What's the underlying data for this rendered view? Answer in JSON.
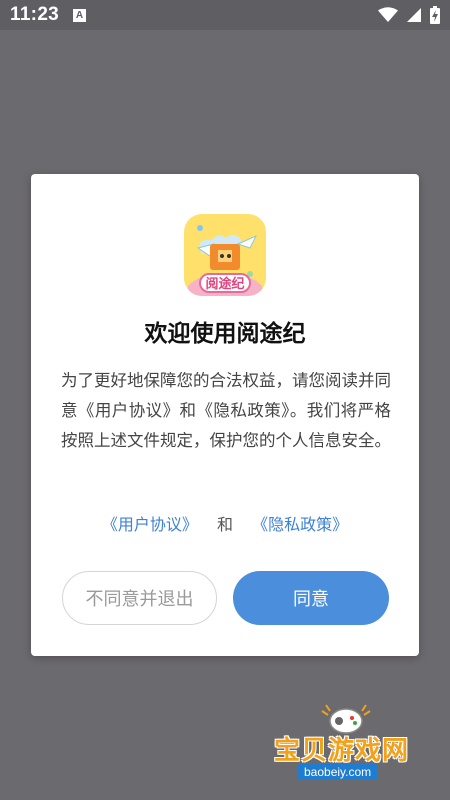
{
  "status_bar": {
    "time": "11:23",
    "notification_badge": "A",
    "icons": [
      "wifi-icon",
      "signal-icon",
      "battery-charging-icon"
    ]
  },
  "dialog": {
    "app_icon_label": "阅途纪",
    "title": "欢迎使用阅途纪",
    "body": "为了更好地保障您的合法权益，请您阅读并同意《用户协议》和《隐私政策》。我们将严格按照上述文件规定，保护您的个人信息安全。",
    "links": {
      "user_agreement": "《用户协议》",
      "and": "和",
      "privacy_policy": "《隐私政策》"
    },
    "buttons": {
      "disagree": "不同意并退出",
      "agree": "同意"
    }
  },
  "watermark": {
    "text": "宝贝游戏网",
    "url": "baobeiy.com"
  },
  "colors": {
    "overlay": "#6b6a6f",
    "accent": "#4a8edc",
    "link": "#3d82d6",
    "watermark": "#f1a21a"
  }
}
